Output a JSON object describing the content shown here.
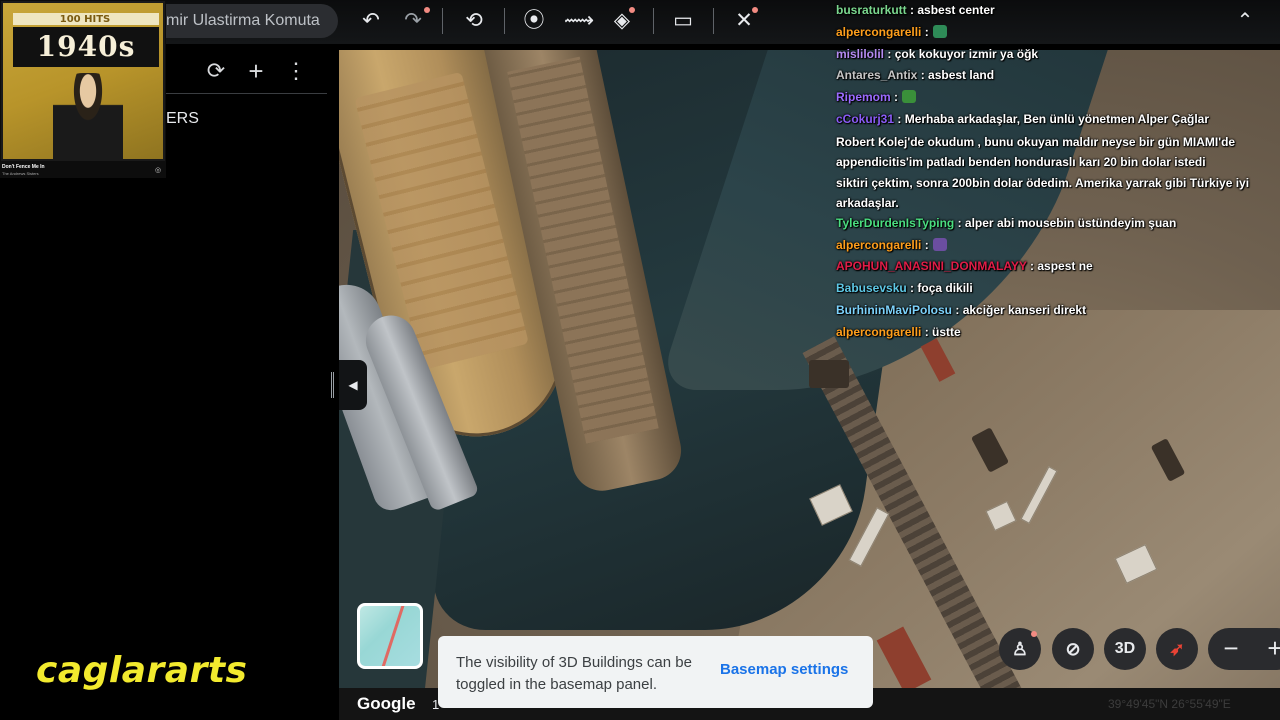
{
  "search": {
    "text": "mir Ulastirma Komuta"
  },
  "sidebar": {
    "partial_text": "ERS",
    "refresh": "⟳",
    "add": "+",
    "more": "⋮",
    "collapse": "◀"
  },
  "album": {
    "badge": "100 HITS",
    "title": "1940s",
    "song": "Don't Fence Me In",
    "artist": "The Andrews Sisters"
  },
  "toolbar": {
    "icons": [
      "undo-icon",
      "redo-icon",
      "history-icon",
      "pin-icon",
      "path-icon",
      "layers-icon",
      "ruler-icon",
      "satellite-icon"
    ],
    "undo": "↶",
    "redo": "↷",
    "history": "⟲",
    "pin": "⦿",
    "path": "⟿",
    "layers": "◈",
    "ruler": "▭",
    "sat": "✕",
    "collapse": "⌃"
  },
  "chat": {
    "messages": [
      {
        "user": "busraturkutt",
        "color": "#7bd88f",
        "text": "asbest center"
      },
      {
        "user": "alpercongarelli",
        "color": "#ff9f1c",
        "text": ""
      },
      {
        "user": "mislilolil",
        "color": "#b48cf2",
        "text": "çok kokuyor izmir ya öğk"
      },
      {
        "user": "Antares_Antix",
        "color": "#c6c6c6",
        "text": "asbest land"
      },
      {
        "user": "Ripemom",
        "color": "#9b6bff",
        "text": ""
      },
      {
        "user": "cCokurj31",
        "color": "#8a5cf6",
        "text": "Merhaba arkadaşlar, Ben ünlü yönetmen Alper Çağlar"
      },
      {
        "user": "",
        "color": "#fff",
        "text": "Robert Kolej'de okudum , bunu okuyan maldır neyse bir gün MIAMI'de"
      },
      {
        "user": "",
        "color": "#fff",
        "text": "appendicitis'im patladı  benden honduraslı karı 20 bin dolar  istedi"
      },
      {
        "user": "",
        "color": "#fff",
        "text": "siktiri çektim, sonra 200bin  dolar ödedim. Amerika yarrak  gibi Türkiye iyi"
      },
      {
        "user": "",
        "color": "#fff",
        "text": "arkadaşlar."
      },
      {
        "user": "TylerDurdenIsTyping",
        "color": "#4ade80",
        "text": "alper abi mousebin üstündeyim şuan"
      },
      {
        "user": "alpercongarelli",
        "color": "#ff9f1c",
        "text": ""
      },
      {
        "user": "APOHUN_ANASINI_DONMALAYY",
        "color": "#e11d48",
        "text": "aspest ne"
      },
      {
        "user": "Babusevsku",
        "color": "#5ec8e5",
        "text": "foça dikili"
      },
      {
        "user": "BurhininMaviPolosu",
        "color": "#7dd3fc",
        "text": "akciğer kanseri direkt"
      },
      {
        "user": "alpercongarelli",
        "color": "#ff9f1c",
        "text": "üstte"
      }
    ]
  },
  "toast": {
    "message": "The visibility of 3D Buildings can be toggled in the basemap panel.",
    "action": "Basemap settings"
  },
  "footer": {
    "google": "Google",
    "scale": "1",
    "coords": "39°49'45\"N 26°55'49\"E"
  },
  "controls": {
    "three_d": "3D",
    "zoom_out": "−",
    "zoom_in": "+"
  },
  "brand": {
    "text": "caglararts"
  },
  "colors": {
    "accent_blue": "#1a73e8",
    "brand_yellow": "#f2ea2e",
    "toast_bg": "#f1f3f4"
  }
}
